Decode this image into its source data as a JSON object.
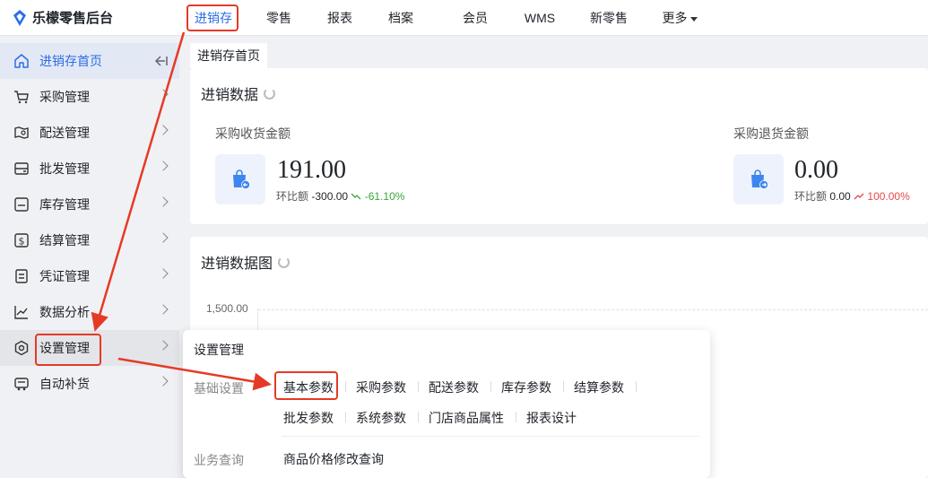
{
  "app": {
    "title": "乐檬零售后台"
  },
  "topnav": {
    "items": [
      {
        "label": "进销存"
      },
      {
        "label": "零售"
      },
      {
        "label": "报表"
      },
      {
        "label": "档案"
      },
      {
        "label": "会员"
      },
      {
        "label": "WMS"
      },
      {
        "label": "新零售"
      },
      {
        "label": "更多"
      }
    ]
  },
  "sidebar": {
    "items": [
      {
        "label": "进销存首页",
        "icon": "home-icon"
      },
      {
        "label": "采购管理",
        "icon": "cart-icon"
      },
      {
        "label": "配送管理",
        "icon": "map-icon"
      },
      {
        "label": "批发管理",
        "icon": "storage-icon"
      },
      {
        "label": "库存管理",
        "icon": "inventory-icon"
      },
      {
        "label": "结算管理",
        "icon": "dollar-icon"
      },
      {
        "label": "凭证管理",
        "icon": "document-icon"
      },
      {
        "label": "数据分析",
        "icon": "chart-icon"
      },
      {
        "label": "设置管理",
        "icon": "settings-icon"
      },
      {
        "label": "自动补货",
        "icon": "truck-icon"
      }
    ]
  },
  "tabs": {
    "home": "进销存首页"
  },
  "summary": {
    "title": "进销数据",
    "purchase_receipt": {
      "label": "采购收货金额",
      "value": "191.00",
      "ratio_label": "环比额",
      "ratio_value": "-300.00",
      "ratio_pct": "-61.10%"
    },
    "purchase_return": {
      "label": "采购退货金额",
      "value": "0.00",
      "ratio_label": "环比额",
      "ratio_value": "0.00",
      "ratio_pct": "100.00%"
    }
  },
  "chart_section": {
    "title": "进销数据图"
  },
  "chart_data": {
    "type": "line",
    "title": "进销数据图",
    "yticks": [
      "1,500.00"
    ],
    "series": []
  },
  "settings_menu": {
    "title": "设置管理",
    "groups": [
      {
        "label": "基础设置",
        "links": [
          "基本参数",
          "采购参数",
          "配送参数",
          "库存参数",
          "结算参数",
          "批发参数",
          "系统参数",
          "门店商品属性",
          "报表设计"
        ]
      },
      {
        "label": "业务查询",
        "links": [
          "商品价格修改查询"
        ]
      }
    ]
  },
  "colors": {
    "accent": "#2b6de5",
    "annotation": "#e53a26",
    "down": "#3aa63a",
    "up": "#e8484b"
  }
}
